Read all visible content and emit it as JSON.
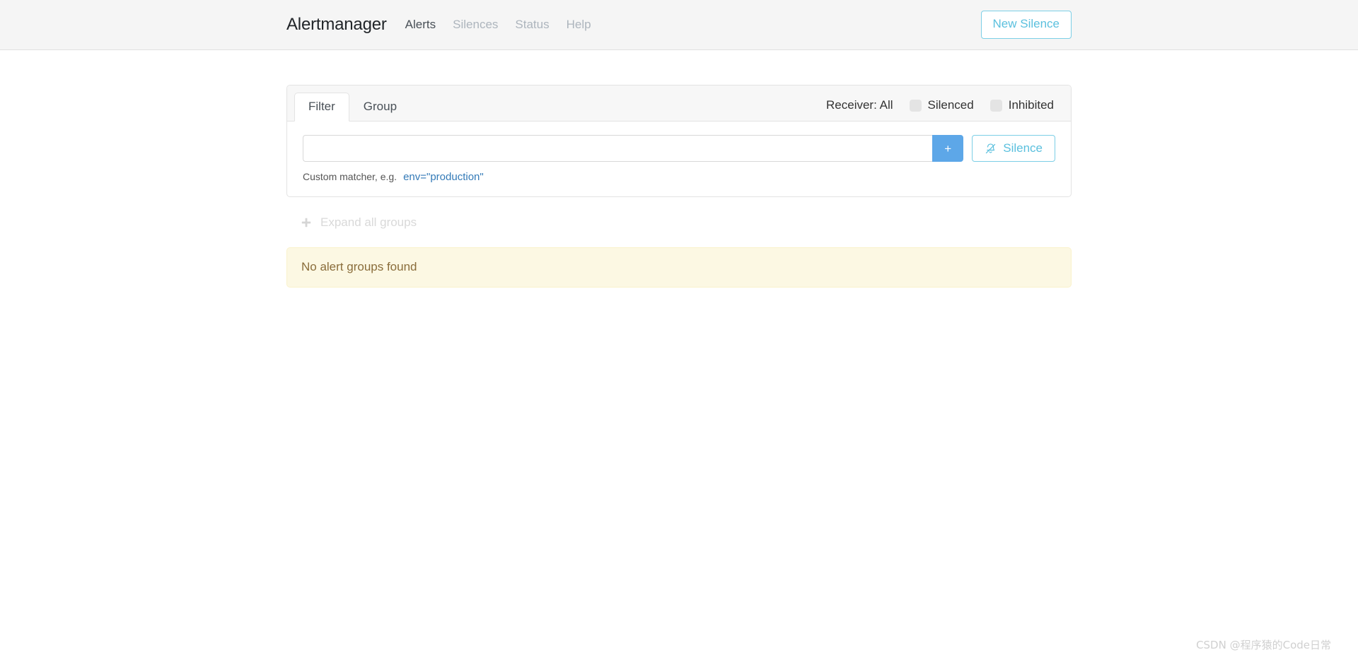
{
  "navbar": {
    "brand": "Alertmanager",
    "links": [
      {
        "label": "Alerts",
        "active": true
      },
      {
        "label": "Silences",
        "active": false
      },
      {
        "label": "Status",
        "active": false
      },
      {
        "label": "Help",
        "active": false
      }
    ],
    "new_silence_label": "New Silence"
  },
  "filter_panel": {
    "tabs": [
      {
        "label": "Filter",
        "active": true
      },
      {
        "label": "Group",
        "active": false
      }
    ],
    "receiver_label": "Receiver: All",
    "toggles": [
      {
        "label": "Silenced",
        "checked": false,
        "icon": "checkbox-icon"
      },
      {
        "label": "Inhibited",
        "checked": false,
        "icon": "checkbox-icon"
      }
    ],
    "filter_input": {
      "value": "",
      "placeholder": ""
    },
    "add_button_label": "+",
    "silence_button_label": "Silence",
    "silence_button_icon": "bell-slash-icon",
    "hint_text": "Custom matcher, e.g.",
    "hint_example": "env=\"production\""
  },
  "groups": {
    "expand_all_label": "Expand all groups",
    "expand_all_icon": "plus-icon",
    "empty_message": "No alert groups found"
  },
  "watermark": "CSDN @程序猿的Code日常",
  "colors": {
    "navbar_bg": "#f5f5f5",
    "accent_blue": "#5bc0de",
    "add_button_blue": "#5da7e8",
    "link_blue": "#337ab7",
    "warning_bg": "#fcf8e3",
    "warning_text": "#8a6d3b",
    "muted_text": "#adb5bd"
  }
}
